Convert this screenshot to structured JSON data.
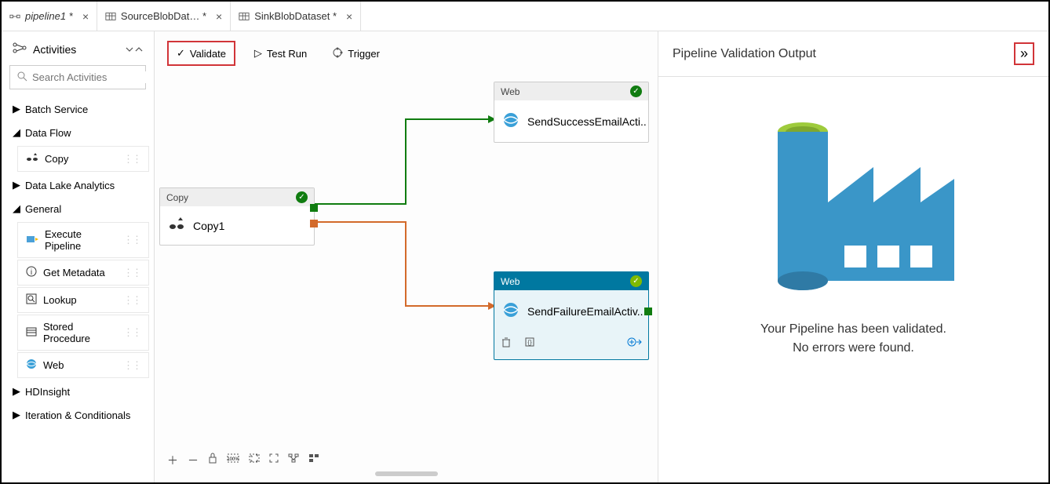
{
  "tabs": [
    {
      "label": "pipeline1 *",
      "type": "pipeline"
    },
    {
      "label": "SourceBlobDat… *",
      "type": "dataset"
    },
    {
      "label": "SinkBlobDataset *",
      "type": "dataset"
    }
  ],
  "sidebar": {
    "title": "Activities",
    "search_placeholder": "Search Activities",
    "groups": [
      {
        "label": "Batch Service",
        "expanded": false,
        "children": []
      },
      {
        "label": "Data Flow",
        "expanded": true,
        "children": [
          {
            "label": "Copy",
            "icon": "copy"
          }
        ]
      },
      {
        "label": "Data Lake Analytics",
        "expanded": false,
        "children": []
      },
      {
        "label": "General",
        "expanded": true,
        "children": [
          {
            "label": "Execute Pipeline",
            "icon": "exec"
          },
          {
            "label": "Get Metadata",
            "icon": "info"
          },
          {
            "label": "Lookup",
            "icon": "lookup"
          },
          {
            "label": "Stored Procedure",
            "icon": "sp"
          },
          {
            "label": "Web",
            "icon": "web"
          }
        ]
      },
      {
        "label": "HDInsight",
        "expanded": false,
        "children": []
      },
      {
        "label": "Iteration & Conditionals",
        "expanded": false,
        "children": []
      }
    ]
  },
  "toolbar": {
    "validate": "Validate",
    "testrun": "Test Run",
    "trigger": "Trigger"
  },
  "nodes": {
    "copy": {
      "type": "Copy",
      "name": "Copy1"
    },
    "success": {
      "type": "Web",
      "name": "SendSuccessEmailActi.."
    },
    "failure": {
      "type": "Web",
      "name": "SendFailureEmailActiv.."
    }
  },
  "right_panel": {
    "title": "Pipeline Validation Output",
    "message1": "Your Pipeline has been validated.",
    "message2": "No errors were found."
  }
}
